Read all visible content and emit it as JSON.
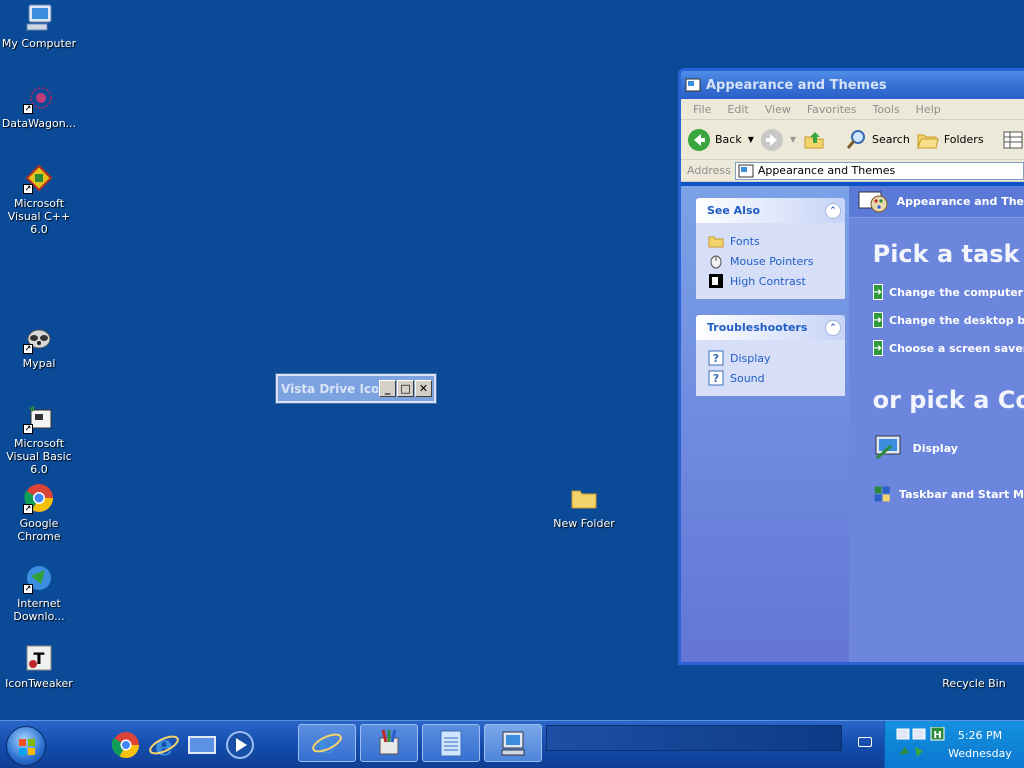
{
  "desktop": {
    "icons": [
      {
        "label": "My Computer"
      },
      {
        "label": "DataWagon..."
      },
      {
        "label": "Microsoft Visual C++ 6.0"
      },
      {
        "label": "Mypal"
      },
      {
        "label": "Microsoft Visual Basic 6.0"
      },
      {
        "label": "Google Chrome"
      },
      {
        "label": "Internet Downlo..."
      },
      {
        "label": "IconTweaker"
      },
      {
        "label": "New Folder"
      },
      {
        "label": "Recycle Bin"
      }
    ]
  },
  "mini_window": {
    "title": "Vista Drive Icon",
    "minimize": "_",
    "maximize": "□",
    "close": "✕"
  },
  "explorer": {
    "title": "Appearance and Themes",
    "menu": [
      "File",
      "Edit",
      "View",
      "Favorites",
      "Tools",
      "Help"
    ],
    "toolbar": {
      "back": "Back",
      "search": "Search",
      "folders": "Folders"
    },
    "address": {
      "label": "Address",
      "value": "Appearance and Themes"
    },
    "see_also": {
      "title": "See Also",
      "items": [
        "Fonts",
        "Mouse Pointers",
        "High Contrast"
      ]
    },
    "troubleshooters": {
      "title": "Troubleshooters",
      "items": [
        "Display",
        "Sound"
      ]
    },
    "main": {
      "header": "Appearance and The",
      "pick_task": "Pick a task",
      "tasks": [
        "Change the computer'",
        "Change the desktop b",
        "Choose a screen saver"
      ],
      "pick_icon": "or pick a Co",
      "categories": [
        "Display",
        "Taskbar and Start M"
      ]
    }
  },
  "taskbar": {
    "clock_time": "5:26 PM",
    "clock_day": "Wednesday"
  },
  "colors": {
    "desktop": "#0a4a96",
    "taskbar": "#144dae",
    "link": "#215dc6"
  }
}
